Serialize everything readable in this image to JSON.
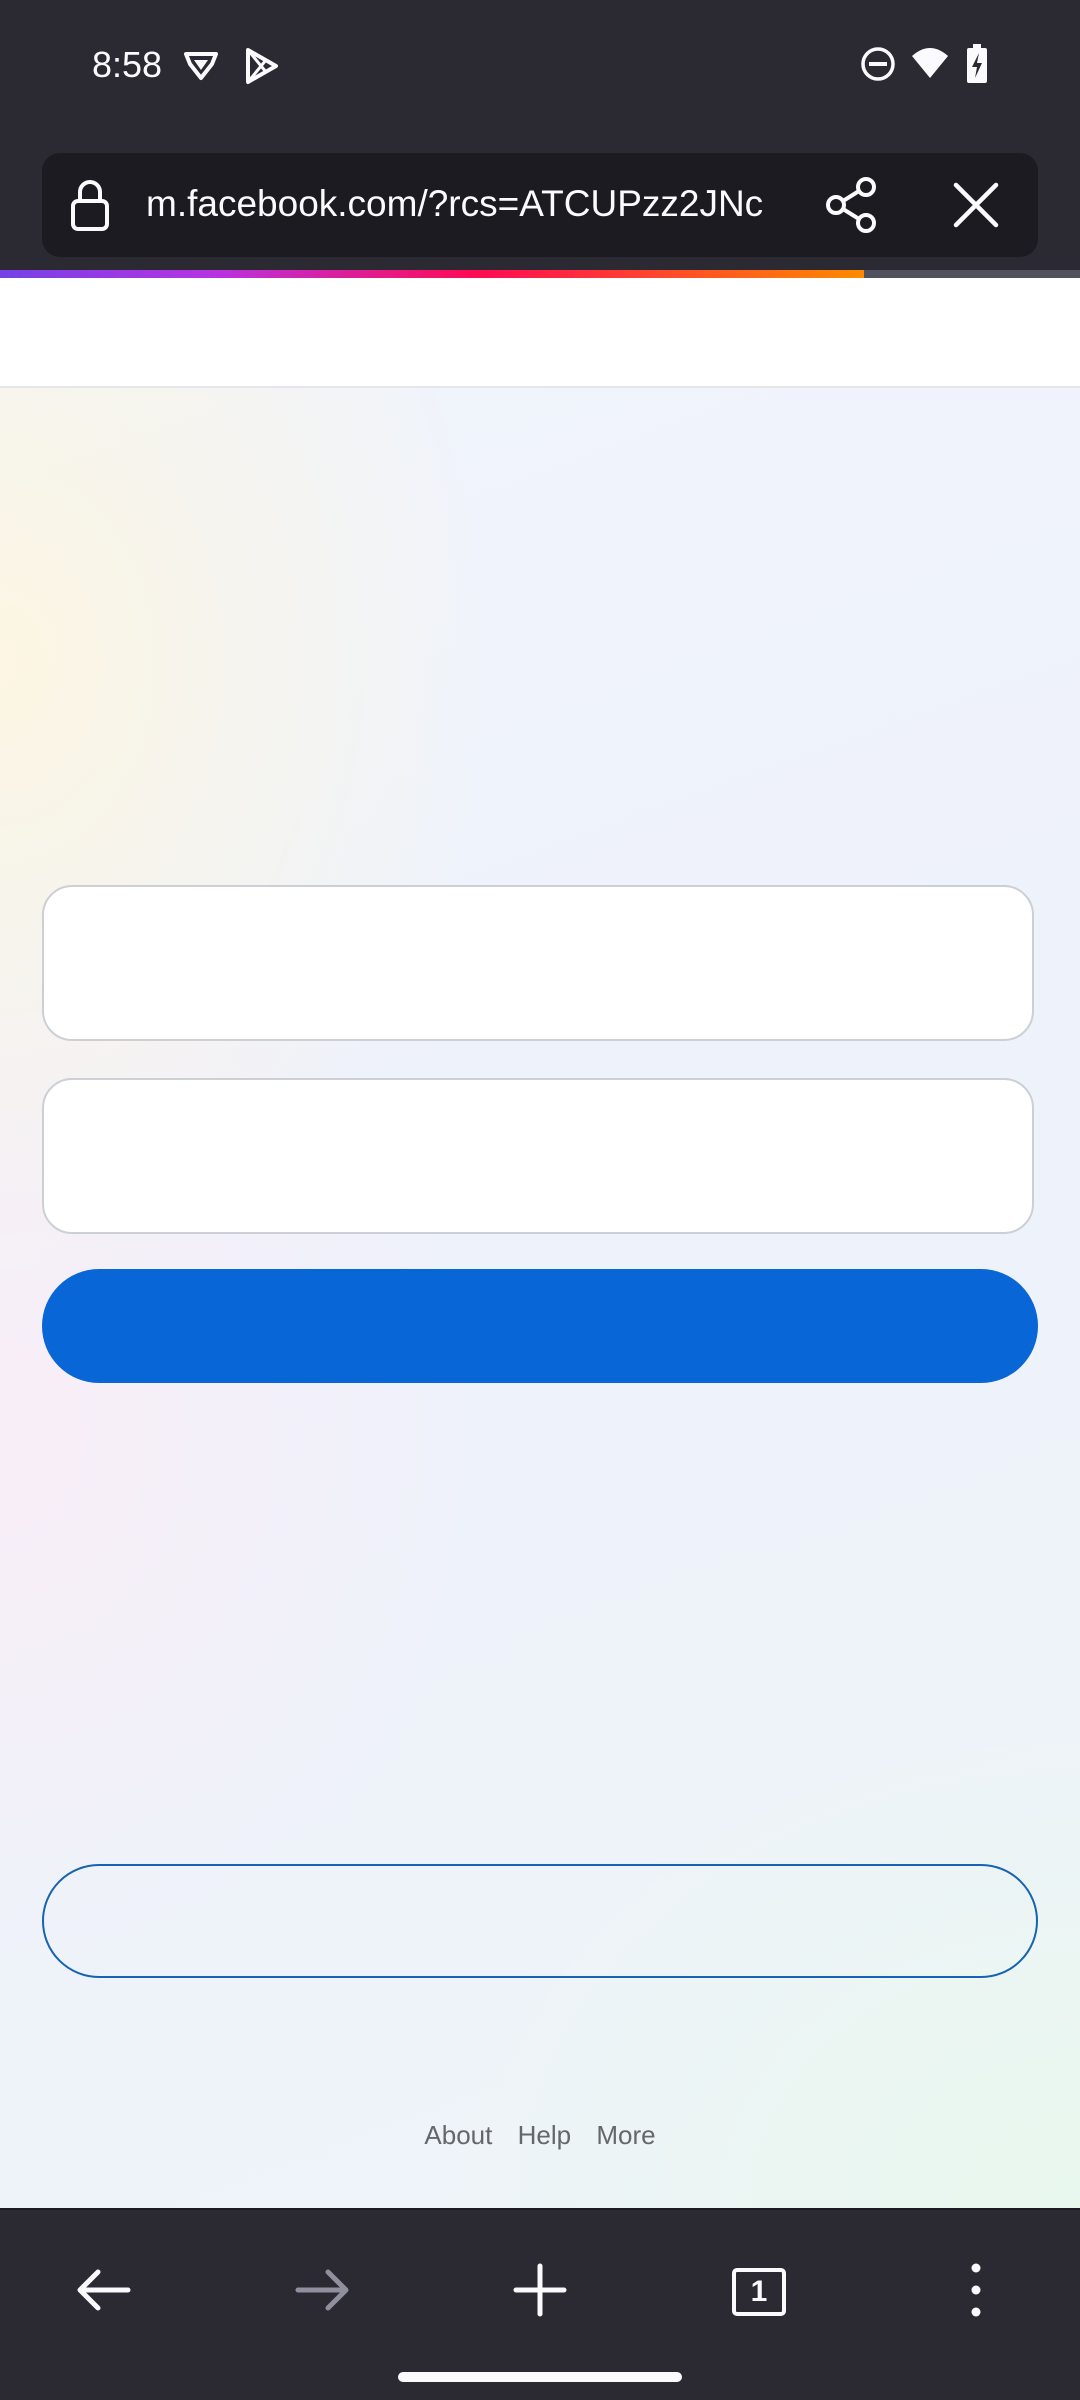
{
  "status_bar": {
    "time": "8:58",
    "left_icons": [
      "vpn-shield-icon",
      "play-store-icon"
    ],
    "right_icons": [
      "do-not-disturb-icon",
      "wifi-icon",
      "battery-charging-icon"
    ]
  },
  "toolbar": {
    "url": "m.facebook.com/?rcs=ATCUPzz2JNc",
    "lock_icon": "lock-icon",
    "share_icon": "share-icon",
    "close_icon": "close-icon",
    "load_progress_percent": 80
  },
  "page": {
    "footer_links": {
      "about": "About",
      "help": "Help",
      "more": "More"
    }
  },
  "bottom_nav": {
    "tab_count": "1",
    "icons": [
      "back-arrow-icon",
      "forward-arrow-icon",
      "new-tab-plus-icon",
      "tab-counter-icon",
      "more-menu-icon"
    ]
  },
  "colors": {
    "chrome": "#2b2a33",
    "url_box": "#1c1b22",
    "primary_button": "#0866d6",
    "outline_button": "#1763b3"
  }
}
